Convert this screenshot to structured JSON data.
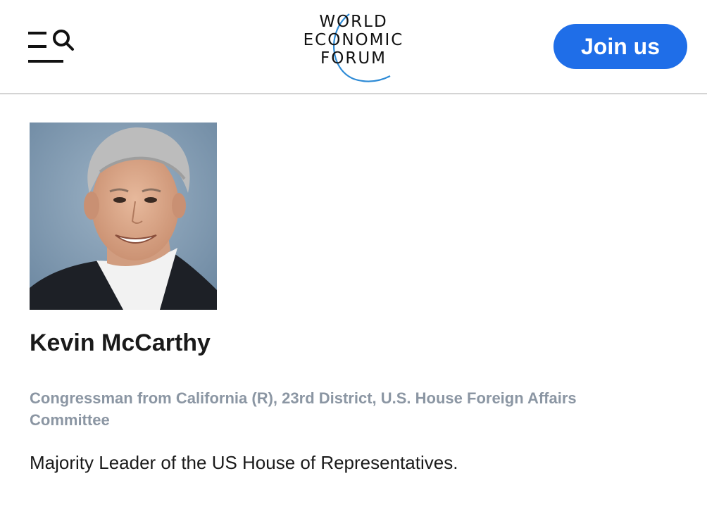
{
  "header": {
    "menu_icon": "menu-icon",
    "search_icon": "search-icon",
    "logo_lines": [
      "WORLD",
      "ECONOMIC",
      "FORUM"
    ],
    "join_label": "Join us",
    "accent_color": "#1f6ee8"
  },
  "profile": {
    "photo_alt": "Kevin McCarthy",
    "name": "Kevin McCarthy",
    "title": "Congressman from California (R), 23rd District, U.S. House Foreign Affairs Committee",
    "bio": "Majority Leader of the US House of Representatives."
  }
}
